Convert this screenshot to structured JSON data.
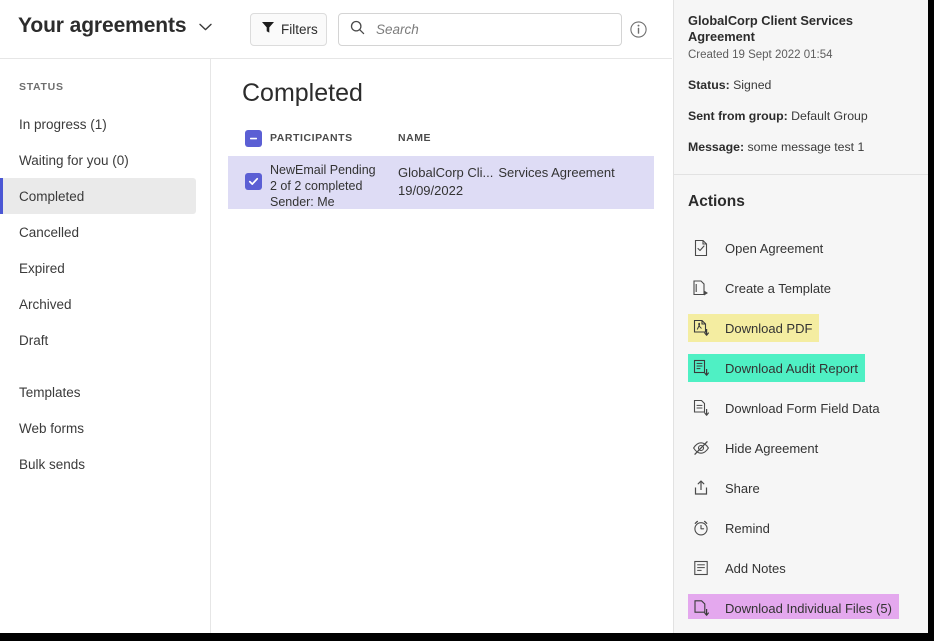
{
  "header": {
    "title": "Your agreements",
    "chevron_icon": "chevron-down-icon",
    "filters_label": "Filters",
    "filter_icon": "funnel-icon",
    "search_placeholder": "Search",
    "search_value": "",
    "search_icon": "search-icon",
    "info_icon": "info-circle-icon"
  },
  "sidebar": {
    "section_label": "STATUS",
    "items": [
      {
        "label": "In progress (1)",
        "active": false
      },
      {
        "label": "Waiting for you (0)",
        "active": false
      },
      {
        "label": "Completed",
        "active": true
      },
      {
        "label": "Cancelled",
        "active": false
      },
      {
        "label": "Expired",
        "active": false
      },
      {
        "label": "Archived",
        "active": false
      },
      {
        "label": "Draft",
        "active": false
      }
    ],
    "items2": [
      {
        "label": "Templates"
      },
      {
        "label": "Web forms"
      },
      {
        "label": "Bulk sends"
      }
    ]
  },
  "main": {
    "section_title": "Completed",
    "columns": {
      "participants": "PARTICIPANTS",
      "name": "NAME"
    },
    "select_all_state": "indeterminate",
    "rows": [
      {
        "checked": true,
        "participants_primary": "NewEmail Pending",
        "participants_secondary": "2 of 2 completed",
        "participants_tertiary": "Sender: Me",
        "name_truncated": "GlobalCorp Cli...",
        "name_rest": "Services Agreement",
        "date": "19/09/2022"
      }
    ]
  },
  "details": {
    "title": "GlobalCorp Client Services Agreement",
    "created": "Created 19 Sept 2022 01:54",
    "fields": [
      {
        "label": "Status:",
        "value": "Signed"
      },
      {
        "label": "Sent from group:",
        "value": "Default Group"
      },
      {
        "label": "Message:",
        "value": "some message test 1"
      }
    ],
    "actions_title": "Actions",
    "actions": [
      {
        "label": "Open Agreement",
        "icon": "document-check-icon",
        "highlight": null
      },
      {
        "label": "Create a Template",
        "icon": "document-copy-icon",
        "highlight": null
      },
      {
        "label": "Download PDF",
        "icon": "pdf-download-icon",
        "highlight": "#f4eda1"
      },
      {
        "label": "Download Audit Report",
        "icon": "report-download-icon",
        "highlight": "#4ff0c4"
      },
      {
        "label": "Download Form Field Data",
        "icon": "form-download-icon",
        "highlight": null
      },
      {
        "label": "Hide Agreement",
        "icon": "eye-off-icon",
        "highlight": null
      },
      {
        "label": "Share",
        "icon": "share-upload-icon",
        "highlight": null
      },
      {
        "label": "Remind",
        "icon": "alarm-clock-icon",
        "highlight": null
      },
      {
        "label": "Add Notes",
        "icon": "notes-icon",
        "highlight": null
      },
      {
        "label": "Download Individual Files (5)",
        "icon": "file-download-icon",
        "highlight": "#e4a8ee"
      }
    ]
  },
  "colors": {
    "accent": "#5b5fd4",
    "row_selected": "#dedcf5",
    "panel_bg": "#f6f6f6",
    "sidebar_active": "#eaeaea"
  }
}
